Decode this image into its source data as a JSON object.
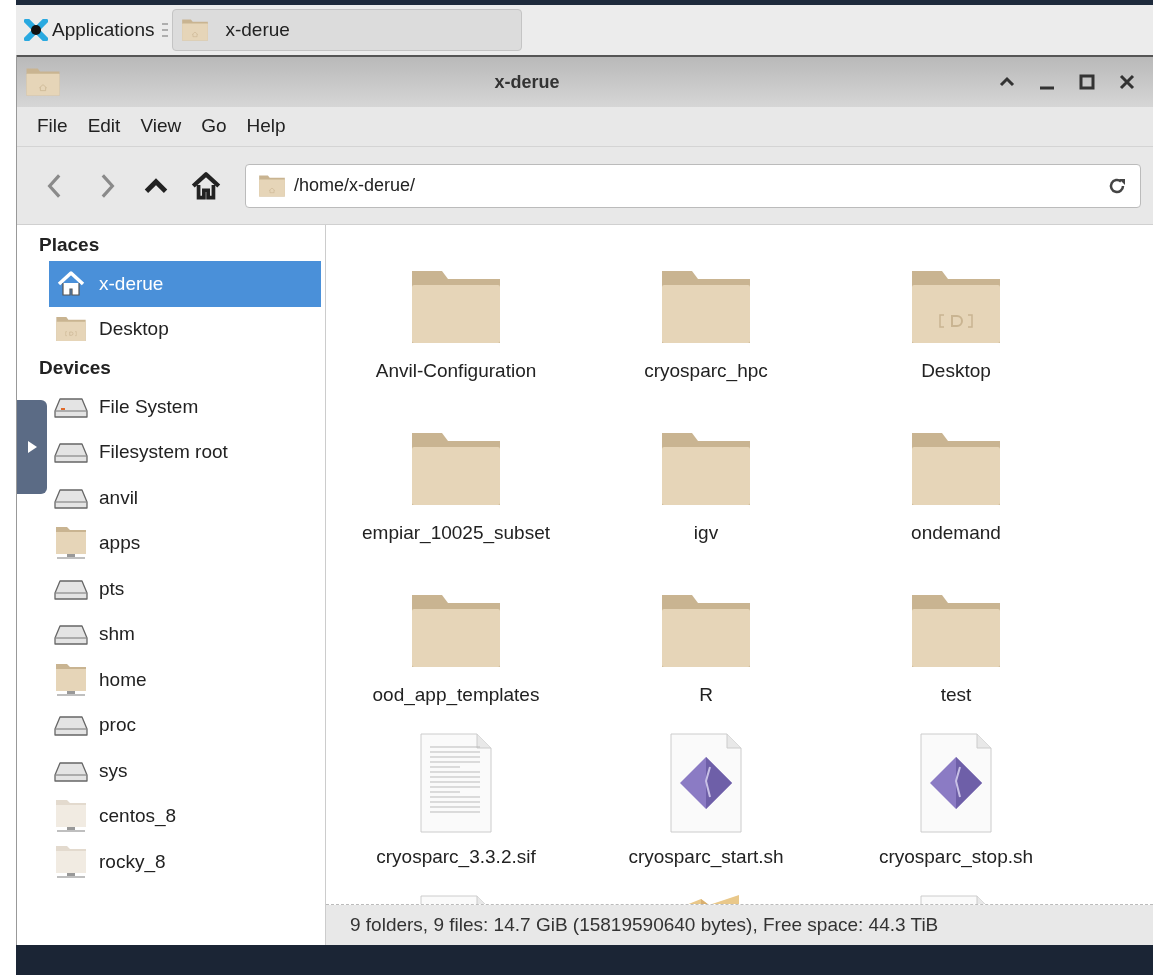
{
  "taskbar": {
    "launcher": "Applications",
    "tasks": [
      {
        "label": "x-derue",
        "selected": true
      }
    ]
  },
  "window": {
    "title": "x-derue"
  },
  "menu": [
    "File",
    "Edit",
    "View",
    "Go",
    "Help"
  ],
  "toolbar": [
    {
      "kind": "back",
      "disabled": true
    },
    {
      "kind": "forward",
      "disabled": true
    },
    {
      "kind": "up",
      "disabled": false
    },
    {
      "kind": "home",
      "disabled": false
    }
  ],
  "location": {
    "value": "/home/x-derue/"
  },
  "sidebar": {
    "sections": [
      {
        "title": "Places",
        "items": [
          {
            "label": "x-derue",
            "kind": "home",
            "selected": true
          },
          {
            "label": "Desktop",
            "kind": "desktop",
            "selected": false
          }
        ]
      },
      {
        "title": "Devices",
        "items": [
          {
            "label": "File System",
            "kind": "system",
            "selected": false
          },
          {
            "label": "Filesystem root",
            "kind": "drive",
            "selected": false
          },
          {
            "label": "anvil",
            "kind": "drive",
            "selected": false
          },
          {
            "label": "apps",
            "kind": "network",
            "selected": false
          },
          {
            "label": "pts",
            "kind": "drive",
            "selected": false
          },
          {
            "label": "shm",
            "kind": "drive",
            "selected": false
          },
          {
            "label": "home",
            "kind": "network",
            "selected": false
          },
          {
            "label": "proc",
            "kind": "drive",
            "selected": false
          },
          {
            "label": "sys",
            "kind": "drive",
            "selected": false
          },
          {
            "label": "centos_8",
            "kind": "network-faded",
            "selected": false
          },
          {
            "label": "rocky_8",
            "kind": "network-faded",
            "selected": false
          }
        ]
      }
    ]
  },
  "files": [
    {
      "name": "Anvil-Configuration",
      "kind": "folder"
    },
    {
      "name": "cryosparc_hpc",
      "kind": "folder"
    },
    {
      "name": "Desktop",
      "kind": "desktop"
    },
    {
      "name": "empiar_10025_subset",
      "kind": "folder"
    },
    {
      "name": "igv",
      "kind": "folder"
    },
    {
      "name": "ondemand",
      "kind": "folder"
    },
    {
      "name": "ood_app_templates",
      "kind": "folder"
    },
    {
      "name": "R",
      "kind": "folder"
    },
    {
      "name": "test",
      "kind": "folder"
    },
    {
      "name": "cryosparc_3.3.2.sif",
      "kind": "text"
    },
    {
      "name": "cryosparc_start.sh",
      "kind": "script"
    },
    {
      "name": "cryosparc_stop.sh",
      "kind": "script"
    },
    {
      "kind": "text"
    },
    {
      "kind": "archive"
    },
    {
      "kind": "text"
    }
  ],
  "status_bar": "9 folders, 9 files: 14.7 GiB (15819590640 bytes), Free space: 44.3 TiB"
}
